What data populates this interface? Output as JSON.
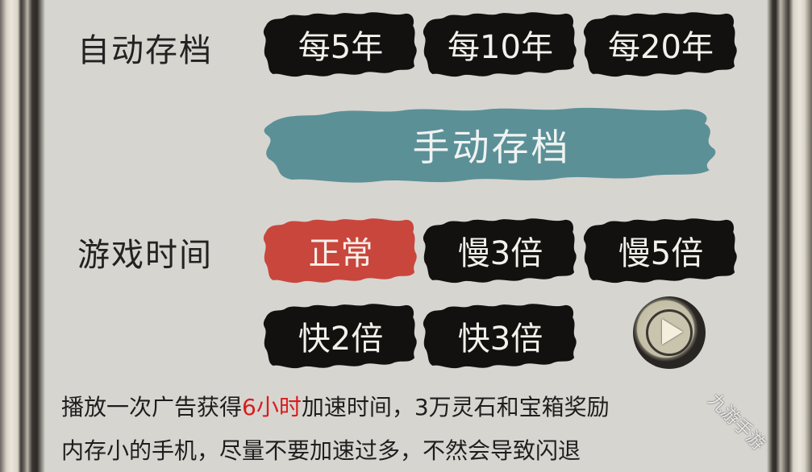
{
  "auto_save": {
    "label": "自动存档",
    "options": [
      "每5年",
      "每10年",
      "每20年"
    ]
  },
  "manual_save": {
    "label": "手动存档"
  },
  "game_time": {
    "label": "游戏时间",
    "selected": "正常",
    "options_row1": [
      "正常",
      "慢3倍",
      "慢5倍"
    ],
    "options_row2": [
      "快2倍",
      "快3倍"
    ]
  },
  "notes": {
    "line1_before": "播放一次广告获得",
    "line1_highlight": "6小时",
    "line1_after": "加速时间，3万灵石和宝箱奖励",
    "line2": "内存小的手机，尽量不要加速过多，不然会导致闪退"
  },
  "watermark": "九游手游",
  "colors": {
    "ink": "#121110",
    "teal": "#5b9097",
    "red": "#c9463c",
    "highlight": "#d81d1d"
  }
}
